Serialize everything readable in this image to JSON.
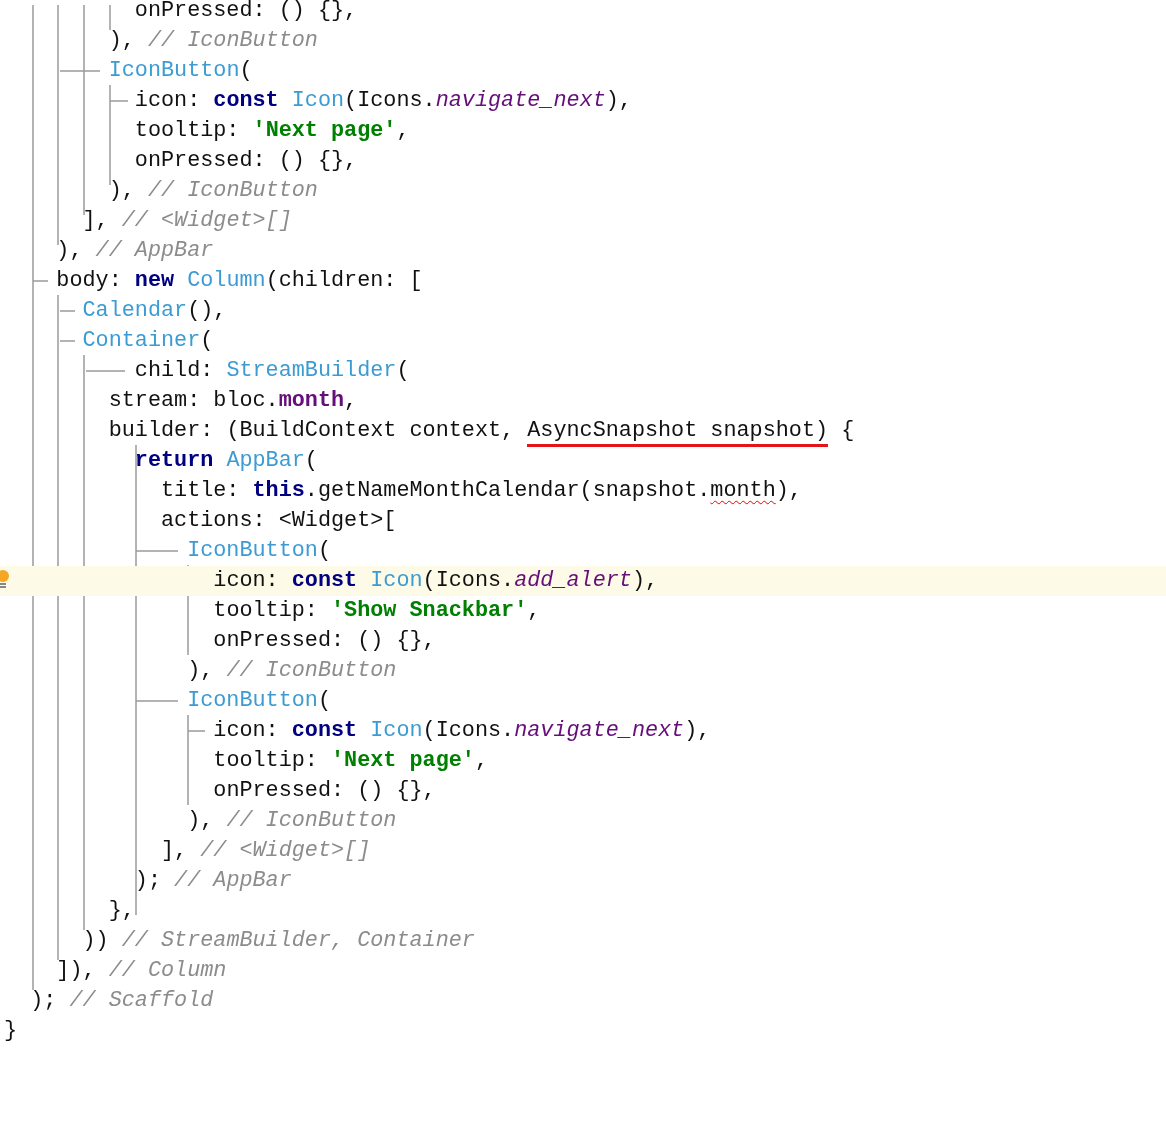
{
  "editor": {
    "lines": [
      {
        "current": false,
        "tokens": [
          {
            "kind": "plain",
            "text": "          onPressed: () {},"
          }
        ]
      },
      {
        "current": false,
        "tokens": [
          {
            "kind": "plain",
            "text": "        ), "
          },
          {
            "kind": "comment",
            "text": "// IconButton"
          }
        ]
      },
      {
        "current": false,
        "tokens": [
          {
            "kind": "type",
            "text": "        IconButton"
          },
          {
            "kind": "plain",
            "text": "("
          }
        ]
      },
      {
        "current": false,
        "tokens": [
          {
            "kind": "plain",
            "text": "          icon: "
          },
          {
            "kind": "keyword",
            "text": "const "
          },
          {
            "kind": "type",
            "text": "Icon"
          },
          {
            "kind": "plain",
            "text": "(Icons."
          },
          {
            "kind": "constant",
            "text": "navigate_next"
          },
          {
            "kind": "plain",
            "text": "),"
          }
        ]
      },
      {
        "current": false,
        "tokens": [
          {
            "kind": "plain",
            "text": "          tooltip: "
          },
          {
            "kind": "string",
            "text": "'Next page'"
          },
          {
            "kind": "plain",
            "text": ","
          }
        ]
      },
      {
        "current": false,
        "tokens": [
          {
            "kind": "plain",
            "text": "          onPressed: () {},"
          }
        ]
      },
      {
        "current": false,
        "tokens": [
          {
            "kind": "plain",
            "text": "        ), "
          },
          {
            "kind": "comment",
            "text": "// IconButton"
          }
        ]
      },
      {
        "current": false,
        "tokens": [
          {
            "kind": "plain",
            "text": "      ], "
          },
          {
            "kind": "comment",
            "text": "// <Widget>[]"
          }
        ]
      },
      {
        "current": false,
        "tokens": [
          {
            "kind": "plain",
            "text": "    ), "
          },
          {
            "kind": "comment",
            "text": "// AppBar"
          }
        ]
      },
      {
        "current": false,
        "tokens": [
          {
            "kind": "plain",
            "text": "    body: "
          },
          {
            "kind": "keyword",
            "text": "new "
          },
          {
            "kind": "type",
            "text": "Column"
          },
          {
            "kind": "plain",
            "text": "(children: ["
          }
        ]
      },
      {
        "current": false,
        "tokens": [
          {
            "kind": "type",
            "text": "      Calendar"
          },
          {
            "kind": "plain",
            "text": "(),"
          }
        ]
      },
      {
        "current": false,
        "tokens": [
          {
            "kind": "type",
            "text": "      Container"
          },
          {
            "kind": "plain",
            "text": "("
          }
        ]
      },
      {
        "current": false,
        "tokens": [
          {
            "kind": "plain",
            "text": "          child: "
          },
          {
            "kind": "type",
            "text": "StreamBuilder"
          },
          {
            "kind": "plain",
            "text": "("
          }
        ]
      },
      {
        "current": false,
        "tokens": [
          {
            "kind": "plain",
            "text": "        stream: bloc."
          },
          {
            "kind": "field",
            "text": "month"
          },
          {
            "kind": "plain",
            "text": ","
          }
        ]
      },
      {
        "current": false,
        "tokens": [
          {
            "kind": "plain",
            "text": "        builder: (BuildContext context, "
          },
          {
            "kind": "annotated",
            "text": "AsyncSnapshot snapshot)"
          },
          {
            "kind": "plain",
            "text": " {"
          }
        ]
      },
      {
        "current": false,
        "tokens": [
          {
            "kind": "keyword",
            "text": "          return "
          },
          {
            "kind": "type",
            "text": "AppBar"
          },
          {
            "kind": "plain",
            "text": "("
          }
        ]
      },
      {
        "current": false,
        "tokens": [
          {
            "kind": "plain",
            "text": "            title: "
          },
          {
            "kind": "keyword",
            "text": "this"
          },
          {
            "kind": "plain",
            "text": ".getNameMonthCalendar(snapshot."
          },
          {
            "kind": "typo",
            "text": "month"
          },
          {
            "kind": "plain",
            "text": "),"
          }
        ]
      },
      {
        "current": false,
        "tokens": [
          {
            "kind": "plain",
            "text": "            actions: <Widget>["
          }
        ]
      },
      {
        "current": false,
        "tokens": [
          {
            "kind": "type",
            "text": "              IconButton"
          },
          {
            "kind": "plain",
            "text": "("
          }
        ]
      },
      {
        "current": true,
        "tokens": [
          {
            "kind": "plain",
            "text": "                icon: "
          },
          {
            "kind": "keyword",
            "text": "const "
          },
          {
            "kind": "type",
            "text": "Icon"
          },
          {
            "kind": "plain",
            "text": "(Icons."
          },
          {
            "kind": "constant",
            "text": "add_alert"
          },
          {
            "kind": "plain",
            "text": "),"
          }
        ]
      },
      {
        "current": false,
        "tokens": [
          {
            "kind": "plain",
            "text": "                tooltip: "
          },
          {
            "kind": "string",
            "text": "'Show Snackbar'"
          },
          {
            "kind": "plain",
            "text": ","
          }
        ]
      },
      {
        "current": false,
        "tokens": [
          {
            "kind": "plain",
            "text": "                onPressed: () {},"
          }
        ]
      },
      {
        "current": false,
        "tokens": [
          {
            "kind": "plain",
            "text": "              ), "
          },
          {
            "kind": "comment",
            "text": "// IconButton"
          }
        ]
      },
      {
        "current": false,
        "tokens": [
          {
            "kind": "type",
            "text": "              IconButton"
          },
          {
            "kind": "plain",
            "text": "("
          }
        ]
      },
      {
        "current": false,
        "tokens": [
          {
            "kind": "plain",
            "text": "                icon: "
          },
          {
            "kind": "keyword",
            "text": "const "
          },
          {
            "kind": "type",
            "text": "Icon"
          },
          {
            "kind": "plain",
            "text": "(Icons."
          },
          {
            "kind": "constant",
            "text": "navigate_next"
          },
          {
            "kind": "plain",
            "text": "),"
          }
        ]
      },
      {
        "current": false,
        "tokens": [
          {
            "kind": "plain",
            "text": "                tooltip: "
          },
          {
            "kind": "string",
            "text": "'Next page'"
          },
          {
            "kind": "plain",
            "text": ","
          }
        ]
      },
      {
        "current": false,
        "tokens": [
          {
            "kind": "plain",
            "text": "                onPressed: () {},"
          }
        ]
      },
      {
        "current": false,
        "tokens": [
          {
            "kind": "plain",
            "text": "              ), "
          },
          {
            "kind": "comment",
            "text": "// IconButton"
          }
        ]
      },
      {
        "current": false,
        "tokens": [
          {
            "kind": "plain",
            "text": "            ], "
          },
          {
            "kind": "comment",
            "text": "// <Widget>[]"
          }
        ]
      },
      {
        "current": false,
        "tokens": [
          {
            "kind": "plain",
            "text": "          ); "
          },
          {
            "kind": "comment",
            "text": "// AppBar"
          }
        ]
      },
      {
        "current": false,
        "tokens": [
          {
            "kind": "plain",
            "text": "        },"
          }
        ]
      },
      {
        "current": false,
        "tokens": [
          {
            "kind": "plain",
            "text": "      )) "
          },
          {
            "kind": "comment",
            "text": "// StreamBuilder, Container"
          }
        ]
      },
      {
        "current": false,
        "tokens": [
          {
            "kind": "plain",
            "text": "    ]), "
          },
          {
            "kind": "comment",
            "text": "// Column"
          }
        ]
      },
      {
        "current": false,
        "tokens": [
          {
            "kind": "plain",
            "text": "  ); "
          },
          {
            "kind": "comment",
            "text": "// Scaffold"
          }
        ]
      },
      {
        "current": false,
        "tokens": [
          {
            "kind": "plain",
            "text": "}"
          }
        ]
      }
    ]
  }
}
